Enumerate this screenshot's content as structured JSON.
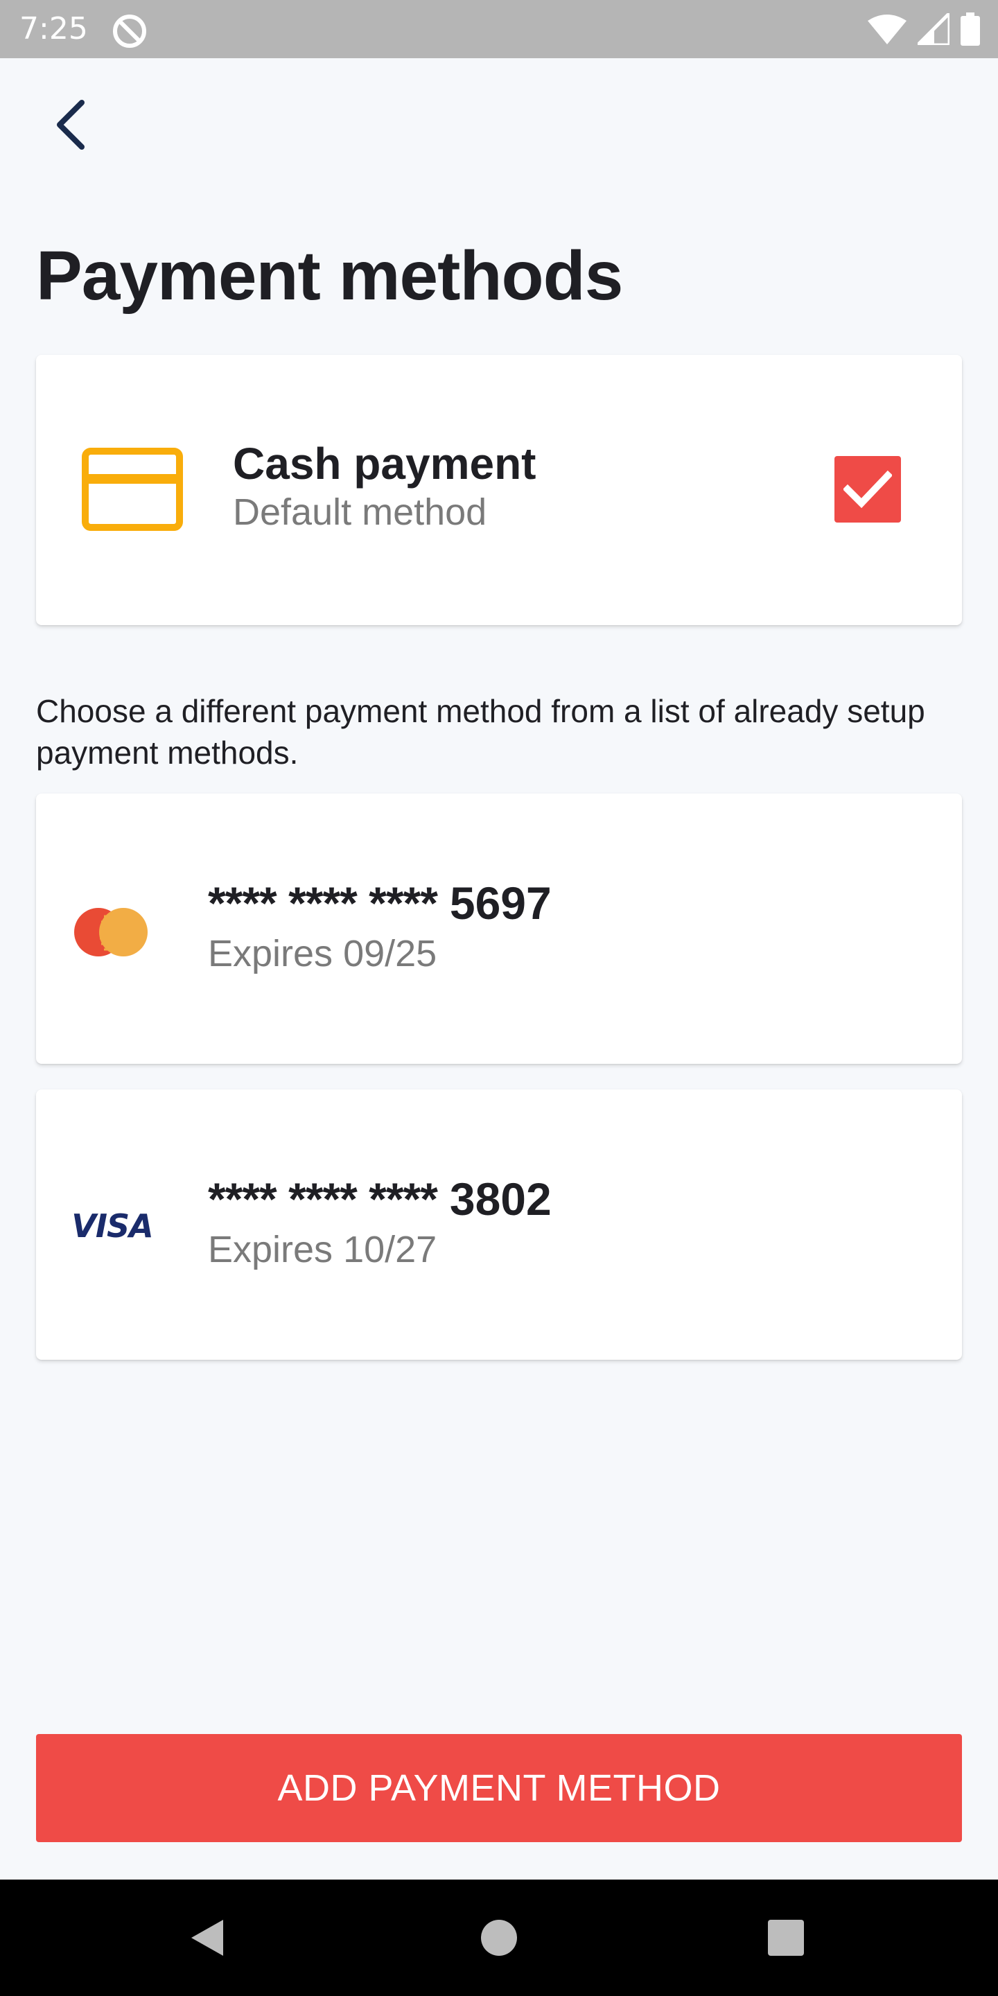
{
  "status_bar": {
    "time": "7:25",
    "icons": [
      "app-notification-icon",
      "wifi-icon",
      "signal-icon",
      "battery-icon"
    ]
  },
  "header": {
    "back_icon": "chevron-left-icon",
    "title": "Payment methods"
  },
  "default_method": {
    "icon": "credit-card-icon",
    "title": "Cash payment",
    "subtitle": "Default method",
    "checked": true
  },
  "description": "Choose a different payment method from a list of already setup payment methods.",
  "cards": [
    {
      "brand": "mastercard",
      "mask": "**** **** ****",
      "last4": "5697",
      "expires": "Expires 09/25"
    },
    {
      "brand": "visa",
      "brand_text": "VISA",
      "mask": "**** **** ****",
      "last4": "3802",
      "expires": "Expires 10/27"
    }
  ],
  "actions": {
    "add_label": "ADD PAYMENT METHOD"
  },
  "colors": {
    "accent": "#ef4b47",
    "cash_icon": "#f9ad0b",
    "status_bar": "#b5b5b5",
    "background": "#f6f8fb"
  }
}
